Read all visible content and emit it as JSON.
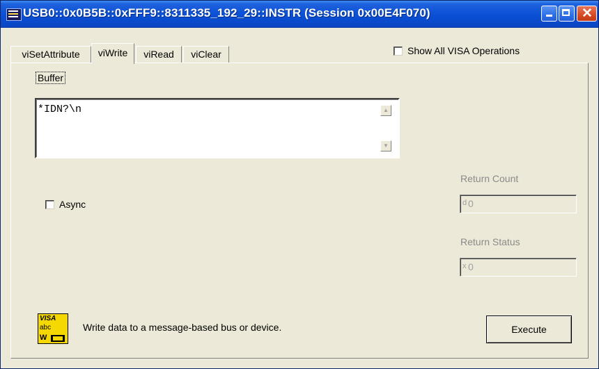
{
  "window": {
    "title": "USB0::0x0B5B::0xFFF9::8311335_192_29::INSTR (Session 0x00E4F070)",
    "buttons": {
      "minimize": "_",
      "maximize": "□",
      "close": "✕"
    }
  },
  "tabs": [
    {
      "label": "viSetAttribute",
      "active": false
    },
    {
      "label": "viWrite",
      "active": true
    },
    {
      "label": "viRead",
      "active": false
    },
    {
      "label": "viClear",
      "active": false
    }
  ],
  "show_all_ops": {
    "label": "Show All VISA Operations",
    "checked": false
  },
  "buffer": {
    "label": "Buffer",
    "value": "*IDN?\\n"
  },
  "async": {
    "label": "Async",
    "checked": false
  },
  "return_count": {
    "label": "Return Count",
    "prefix": "d",
    "value": "0"
  },
  "return_status": {
    "label": "Return Status",
    "prefix": "x",
    "value": "0"
  },
  "visa_icon": {
    "line1": "VISA",
    "line2": "abc",
    "line3": "W"
  },
  "description": "Write data to a message-based bus or device.",
  "execute_button": {
    "label": "Execute"
  },
  "colors": {
    "titlebar": "#0a4fd6",
    "face": "#ece9d8",
    "icon": "#f5d800"
  }
}
